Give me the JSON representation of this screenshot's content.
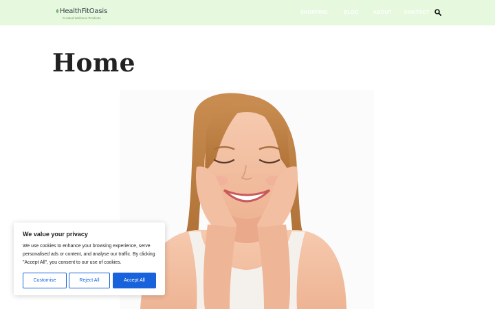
{
  "header": {
    "logo_text": "HealthFitOasis",
    "logo_tagline": "Curated Wellness Products",
    "nav": [
      {
        "label": "SHOPPING"
      },
      {
        "label": "BLOG"
      },
      {
        "label": "ABOUT"
      },
      {
        "label": "CONTACT"
      }
    ],
    "search_icon": "search-icon"
  },
  "page": {
    "title": "Home"
  },
  "cookie_banner": {
    "title": "We value your privacy",
    "text": "We use cookies to enhance your browsing experience, serve personalised ads or content, and analyse our traffic. By clicking \"Accept All\", you consent to our use of cookies.",
    "buttons": {
      "customise": "Customise",
      "reject": "Reject All",
      "accept": "Accept All"
    }
  },
  "colors": {
    "header_bg": "#e6f9df",
    "brand_green": "#6a9a55",
    "accent_blue": "#1863dc"
  }
}
